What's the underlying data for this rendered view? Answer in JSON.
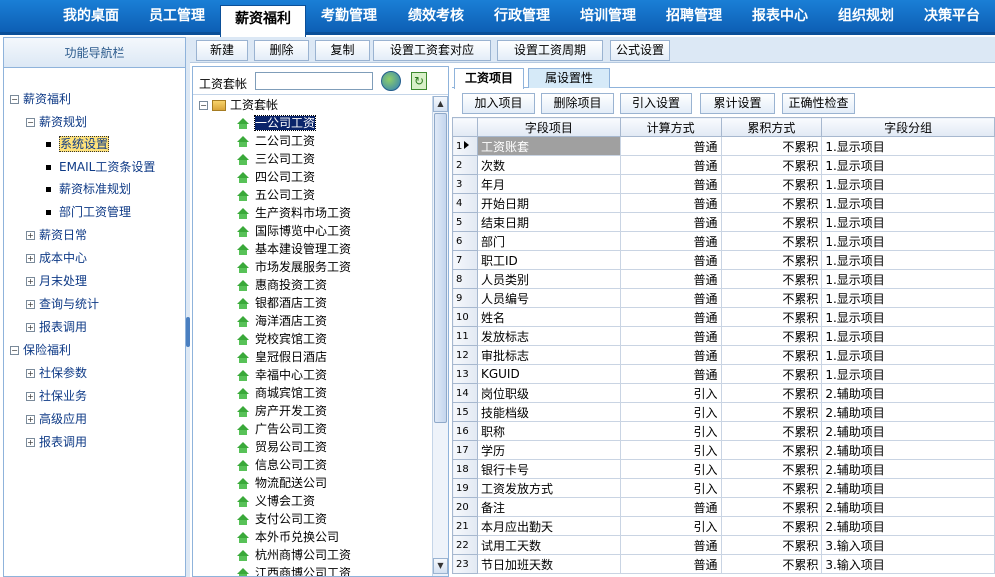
{
  "topnav": [
    "我的桌面",
    "员工管理",
    "薪资福利",
    "考勤管理",
    "绩效考核",
    "行政管理",
    "培训管理",
    "招聘管理",
    "报表中心",
    "组织规划",
    "决策平台"
  ],
  "topnav_active": 2,
  "left": {
    "title": "功能导航栏",
    "nodes": [
      {
        "label": "薪资福利",
        "type": "minus",
        "level": 0
      },
      {
        "label": "薪资规划",
        "type": "minus",
        "level": 1
      },
      {
        "label": "系统设置",
        "type": "bullet",
        "level": 2,
        "selected": true
      },
      {
        "label": "EMAIL工资条设置",
        "type": "bullet",
        "level": 2
      },
      {
        "label": "薪资标准规划",
        "type": "bullet",
        "level": 2
      },
      {
        "label": "部门工资管理",
        "type": "bullet",
        "level": 2
      },
      {
        "label": "薪资日常",
        "type": "plus",
        "level": 1
      },
      {
        "label": "成本中心",
        "type": "plus",
        "level": 1
      },
      {
        "label": "月末处理",
        "type": "plus",
        "level": 1
      },
      {
        "label": "查询与统计",
        "type": "plus",
        "level": 1
      },
      {
        "label": "报表调用",
        "type": "plus",
        "level": 1
      },
      {
        "label": "保险福利",
        "type": "minus",
        "level": 0
      },
      {
        "label": "社保参数",
        "type": "plus",
        "level": 1
      },
      {
        "label": "社保业务",
        "type": "plus",
        "level": 1
      },
      {
        "label": "高级应用",
        "type": "plus",
        "level": 1
      },
      {
        "label": "报表调用",
        "type": "plus",
        "level": 1
      }
    ]
  },
  "toolbar": [
    "新建",
    "删除",
    "复制",
    "设置工资套对应",
    "设置工资周期",
    "公式设置"
  ],
  "tree": {
    "search_label": "工资套帐",
    "search_value": "",
    "root": "工资套帐",
    "items": [
      "一公司工资",
      "二公司工资",
      "三公司工资",
      "四公司工资",
      "五公司工资",
      "生产资料市场工资",
      "国际博览中心工资",
      "基本建设管理工资",
      "市场发展服务工资",
      "惠商投资工资",
      "银都酒店工资",
      "海洋酒店工资",
      "党校宾馆工资",
      "皇冠假日酒店",
      "幸福中心工资",
      "商城宾馆工资",
      "房产开发工资",
      "广告公司工资",
      "贸易公司工资",
      "信息公司工资",
      "物流配送公司",
      "义博会工资",
      "支付公司工资",
      "本外币兑换公司",
      "杭州商博公司工资",
      "江西商博公司工资"
    ],
    "selected": 0
  },
  "tabs": [
    "工资项目",
    "属设置性"
  ],
  "subtoolbar": [
    "加入项目",
    "删除项目",
    "引入设置",
    "累计设置",
    "正确性检查"
  ],
  "grid": {
    "headers": [
      "字段项目",
      "计算方式",
      "累积方式",
      "字段分组"
    ],
    "rows": [
      [
        "1",
        "工资账套",
        "普通",
        "不累积",
        "1.显示项目"
      ],
      [
        "2",
        "次数",
        "普通",
        "不累积",
        "1.显示项目"
      ],
      [
        "3",
        "年月",
        "普通",
        "不累积",
        "1.显示项目"
      ],
      [
        "4",
        "开始日期",
        "普通",
        "不累积",
        "1.显示项目"
      ],
      [
        "5",
        "结束日期",
        "普通",
        "不累积",
        "1.显示项目"
      ],
      [
        "6",
        "部门",
        "普通",
        "不累积",
        "1.显示项目"
      ],
      [
        "7",
        "职工ID",
        "普通",
        "不累积",
        "1.显示项目"
      ],
      [
        "8",
        "人员类别",
        "普通",
        "不累积",
        "1.显示项目"
      ],
      [
        "9",
        "人员编号",
        "普通",
        "不累积",
        "1.显示项目"
      ],
      [
        "10",
        "姓名",
        "普通",
        "不累积",
        "1.显示项目"
      ],
      [
        "11",
        "发放标志",
        "普通",
        "不累积",
        "1.显示项目"
      ],
      [
        "12",
        "审批标志",
        "普通",
        "不累积",
        "1.显示项目"
      ],
      [
        "13",
        "KGUID",
        "普通",
        "不累积",
        "1.显示项目"
      ],
      [
        "14",
        "岗位职级",
        "引入",
        "不累积",
        "2.辅助项目"
      ],
      [
        "15",
        "技能档级",
        "引入",
        "不累积",
        "2.辅助项目"
      ],
      [
        "16",
        "职称",
        "引入",
        "不累积",
        "2.辅助项目"
      ],
      [
        "17",
        "学历",
        "引入",
        "不累积",
        "2.辅助项目"
      ],
      [
        "18",
        "银行卡号",
        "引入",
        "不累积",
        "2.辅助项目"
      ],
      [
        "19",
        "工资发放方式",
        "引入",
        "不累积",
        "2.辅助项目"
      ],
      [
        "20",
        "备注",
        "普通",
        "不累积",
        "2.辅助项目"
      ],
      [
        "21",
        "本月应出勤天",
        "引入",
        "不累积",
        "2.辅助项目"
      ],
      [
        "22",
        "试用工天数",
        "普通",
        "不累积",
        "3.输入项目"
      ],
      [
        "23",
        "节日加班天数",
        "普通",
        "不累积",
        "3.输入项目"
      ]
    ]
  }
}
